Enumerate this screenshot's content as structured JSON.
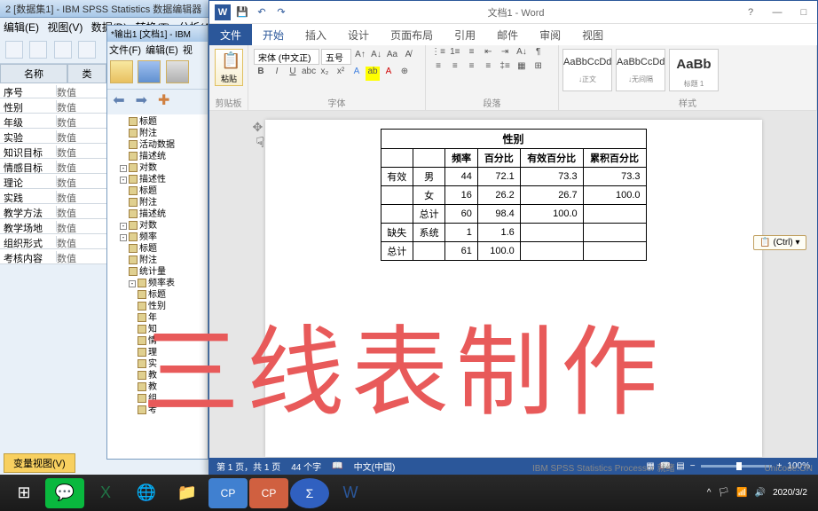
{
  "spss": {
    "title": "2 [数据集1] - IBM SPSS Statistics 数据编辑器",
    "menu": [
      "编辑(E)",
      "视图(V)",
      "数据(D)",
      "转换(T)",
      "分析(A)"
    ],
    "grid_head": [
      "名称",
      "类"
    ],
    "rows": [
      {
        "name": "序号",
        "type": "数值"
      },
      {
        "name": "性别",
        "type": "数值"
      },
      {
        "name": "年级",
        "type": "数值"
      },
      {
        "name": "实验",
        "type": "数值"
      },
      {
        "name": "知识目标",
        "type": "数值"
      },
      {
        "name": "情感目标",
        "type": "数值"
      },
      {
        "name": "理论",
        "type": "数值"
      },
      {
        "name": "实践",
        "type": "数值"
      },
      {
        "name": "教学方法",
        "type": "数值"
      },
      {
        "name": "教学场地",
        "type": "数值"
      },
      {
        "name": "组织形式",
        "type": "数值"
      },
      {
        "name": "考核内容",
        "type": "数值"
      }
    ],
    "tab": "变量视图(V)",
    "status": "IBM SPSS Statistics Processor 就绪",
    "status2": "Unicode:ON"
  },
  "spss_out": {
    "title": "*输出1 [文档1] - IBM",
    "menu": [
      "文件(F)",
      "编辑(E)",
      "视"
    ],
    "tree": [
      {
        "l": 2,
        "t": "标题"
      },
      {
        "l": 2,
        "t": "附注"
      },
      {
        "l": 2,
        "t": "活动数据"
      },
      {
        "l": 2,
        "t": "描述统"
      },
      {
        "l": 1,
        "t": "对数",
        "box": "-"
      },
      {
        "l": 1,
        "t": "描述性",
        "box": "-"
      },
      {
        "l": 2,
        "t": "标题"
      },
      {
        "l": 2,
        "t": "附注"
      },
      {
        "l": 2,
        "t": "描述统"
      },
      {
        "l": 1,
        "t": "对数",
        "box": "-"
      },
      {
        "l": 1,
        "t": "频率",
        "box": "-"
      },
      {
        "l": 2,
        "t": "标题"
      },
      {
        "l": 2,
        "t": "附注"
      },
      {
        "l": 2,
        "t": "统计量"
      },
      {
        "l": 2,
        "t": "频率表",
        "box": "-"
      },
      {
        "l": 3,
        "t": "标题"
      },
      {
        "l": 3,
        "t": "性别"
      },
      {
        "l": 3,
        "t": "年"
      },
      {
        "l": 3,
        "t": "知"
      },
      {
        "l": 3,
        "t": "情"
      },
      {
        "l": 3,
        "t": "理"
      },
      {
        "l": 3,
        "t": "实"
      },
      {
        "l": 3,
        "t": "教"
      },
      {
        "l": 3,
        "t": "教"
      },
      {
        "l": 3,
        "t": "组"
      },
      {
        "l": 3,
        "t": "考"
      }
    ]
  },
  "word": {
    "doc_title": "文档1 - Word",
    "tabs": [
      "文件",
      "开始",
      "插入",
      "设计",
      "页面布局",
      "引用",
      "邮件",
      "审阅",
      "视图"
    ],
    "ribbon": {
      "clipboard": "剪贴板",
      "paste": "粘贴",
      "font": "字体",
      "font_name": "宋体 (中文正)",
      "font_size": "五号",
      "para": "段落",
      "styles_label": "样式",
      "styles": [
        {
          "sample": "AaBbCcDd",
          "name": "↓正文"
        },
        {
          "sample": "AaBbCcDd",
          "name": "↓无间隔"
        },
        {
          "sample": "AaBb",
          "name": "标题 1"
        }
      ]
    },
    "table": {
      "title": "性别",
      "headers": [
        "",
        "",
        "频率",
        "百分比",
        "有效百分比",
        "累积百分比"
      ],
      "rows": [
        [
          "有效",
          "男",
          "44",
          "72.1",
          "73.3",
          "73.3"
        ],
        [
          "",
          "女",
          "16",
          "26.2",
          "26.7",
          "100.0"
        ],
        [
          "",
          "总计",
          "60",
          "98.4",
          "100.0",
          ""
        ],
        [
          "缺失",
          "系统",
          "1",
          "1.6",
          "",
          ""
        ],
        [
          "总计",
          "",
          "61",
          "100.0",
          "",
          ""
        ]
      ]
    },
    "ctrl_badge": "(Ctrl) ▾",
    "status": {
      "page": "第 1 页，共 1 页",
      "words": "44 个字",
      "lang": "中文(中国)",
      "zoom": "100%"
    }
  },
  "overlay": "三线表制作",
  "taskbar": {
    "time": "2020/3/2"
  }
}
